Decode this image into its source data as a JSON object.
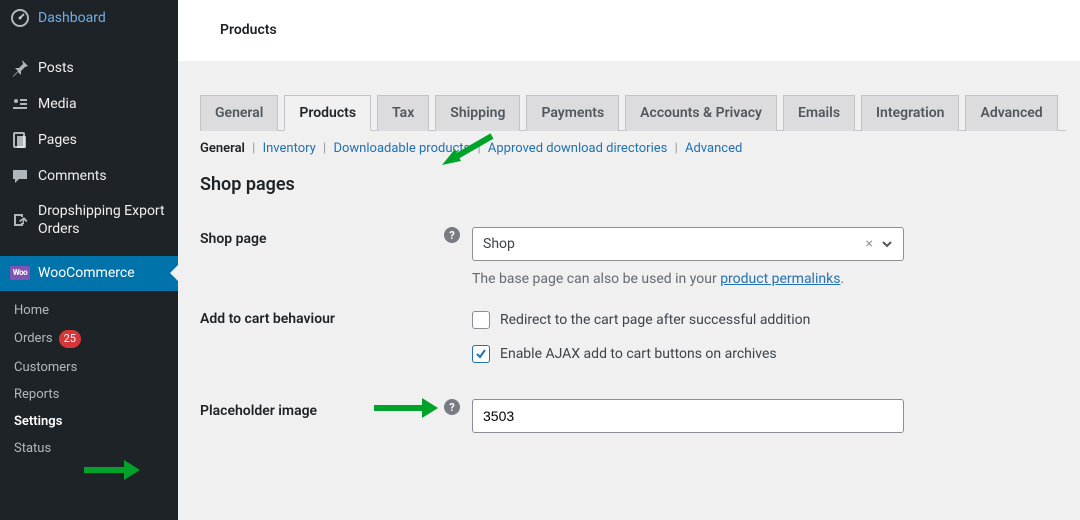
{
  "sidebar": {
    "items": [
      {
        "label": "Dashboard"
      },
      {
        "label": "Posts"
      },
      {
        "label": "Media"
      },
      {
        "label": "Pages"
      },
      {
        "label": "Comments"
      },
      {
        "label": "Dropshipping Export Orders"
      },
      {
        "label": "WooCommerce",
        "badge": "Woo"
      }
    ],
    "submenu": {
      "items": [
        {
          "label": "Home"
        },
        {
          "label": "Orders",
          "count": "25"
        },
        {
          "label": "Customers"
        },
        {
          "label": "Reports"
        },
        {
          "label": "Settings",
          "current": true
        },
        {
          "label": "Status"
        }
      ]
    }
  },
  "header": {
    "title": "Products"
  },
  "tabs": [
    {
      "label": "General"
    },
    {
      "label": "Products",
      "active": true
    },
    {
      "label": "Tax"
    },
    {
      "label": "Shipping"
    },
    {
      "label": "Payments"
    },
    {
      "label": "Accounts & Privacy"
    },
    {
      "label": "Emails"
    },
    {
      "label": "Integration"
    },
    {
      "label": "Advanced"
    }
  ],
  "subsections": {
    "items": [
      {
        "label": "General",
        "current": true
      },
      {
        "label": "Inventory"
      },
      {
        "label": "Downloadable products"
      },
      {
        "label": "Approved download directories"
      },
      {
        "label": "Advanced"
      }
    ]
  },
  "section_title": "Shop pages",
  "shop_page": {
    "label": "Shop page",
    "value": "Shop",
    "help_text_prefix": "The base page can also be used in your ",
    "help_link_text": "product permalinks",
    "help_text_suffix": "."
  },
  "add_to_cart": {
    "label": "Add to cart behaviour",
    "option_redirect": "Redirect to the cart page after successful addition",
    "option_ajax": "Enable AJAX add to cart buttons on archives",
    "redirect_checked": false,
    "ajax_checked": true
  },
  "placeholder_image": {
    "label": "Placeholder image",
    "value": "3503"
  },
  "help_glyph": "?"
}
